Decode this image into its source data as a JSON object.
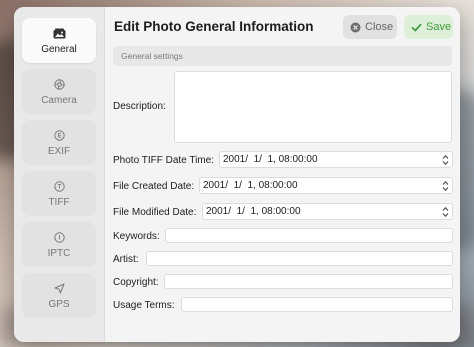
{
  "dialog": {
    "title": "Edit Photo General Information",
    "close_label": "Close",
    "save_label": "Save",
    "section_header": "General settings"
  },
  "sidebar": {
    "items": [
      {
        "label": "General",
        "icon": "photo-icon",
        "active": true
      },
      {
        "label": "Camera",
        "icon": "aperture-icon",
        "active": false
      },
      {
        "label": "EXIF",
        "icon": "exif-icon",
        "active": false
      },
      {
        "label": "TIFF",
        "icon": "tiff-icon",
        "active": false
      },
      {
        "label": "IPTC",
        "icon": "info-icon",
        "active": false
      },
      {
        "label": "GPS",
        "icon": "location-arrow-icon",
        "active": false
      }
    ]
  },
  "form": {
    "description": {
      "label": "Description:",
      "value": ""
    },
    "tiff_date": {
      "label": "Photo TIFF Date Time:",
      "value": "2001/  1/  1, 08:00:00"
    },
    "created_date": {
      "label": "File Created Date:",
      "value": "2001/  1/  1, 08:00:00"
    },
    "modified_date": {
      "label": "File Modified Date:",
      "value": "2001/  1/  1, 08:00:00"
    },
    "keywords": {
      "label": "Keywords:",
      "value": ""
    },
    "artist": {
      "label": "Artist:",
      "value": ""
    },
    "copyright": {
      "label": "Copyright:",
      "value": ""
    },
    "usage_terms": {
      "label": "Usage Terms:",
      "value": ""
    }
  },
  "colors": {
    "save_accent": "#3c9b3c",
    "sidebar_bg": "#e9e9e9",
    "panel_bg": "#f4f4f4"
  }
}
